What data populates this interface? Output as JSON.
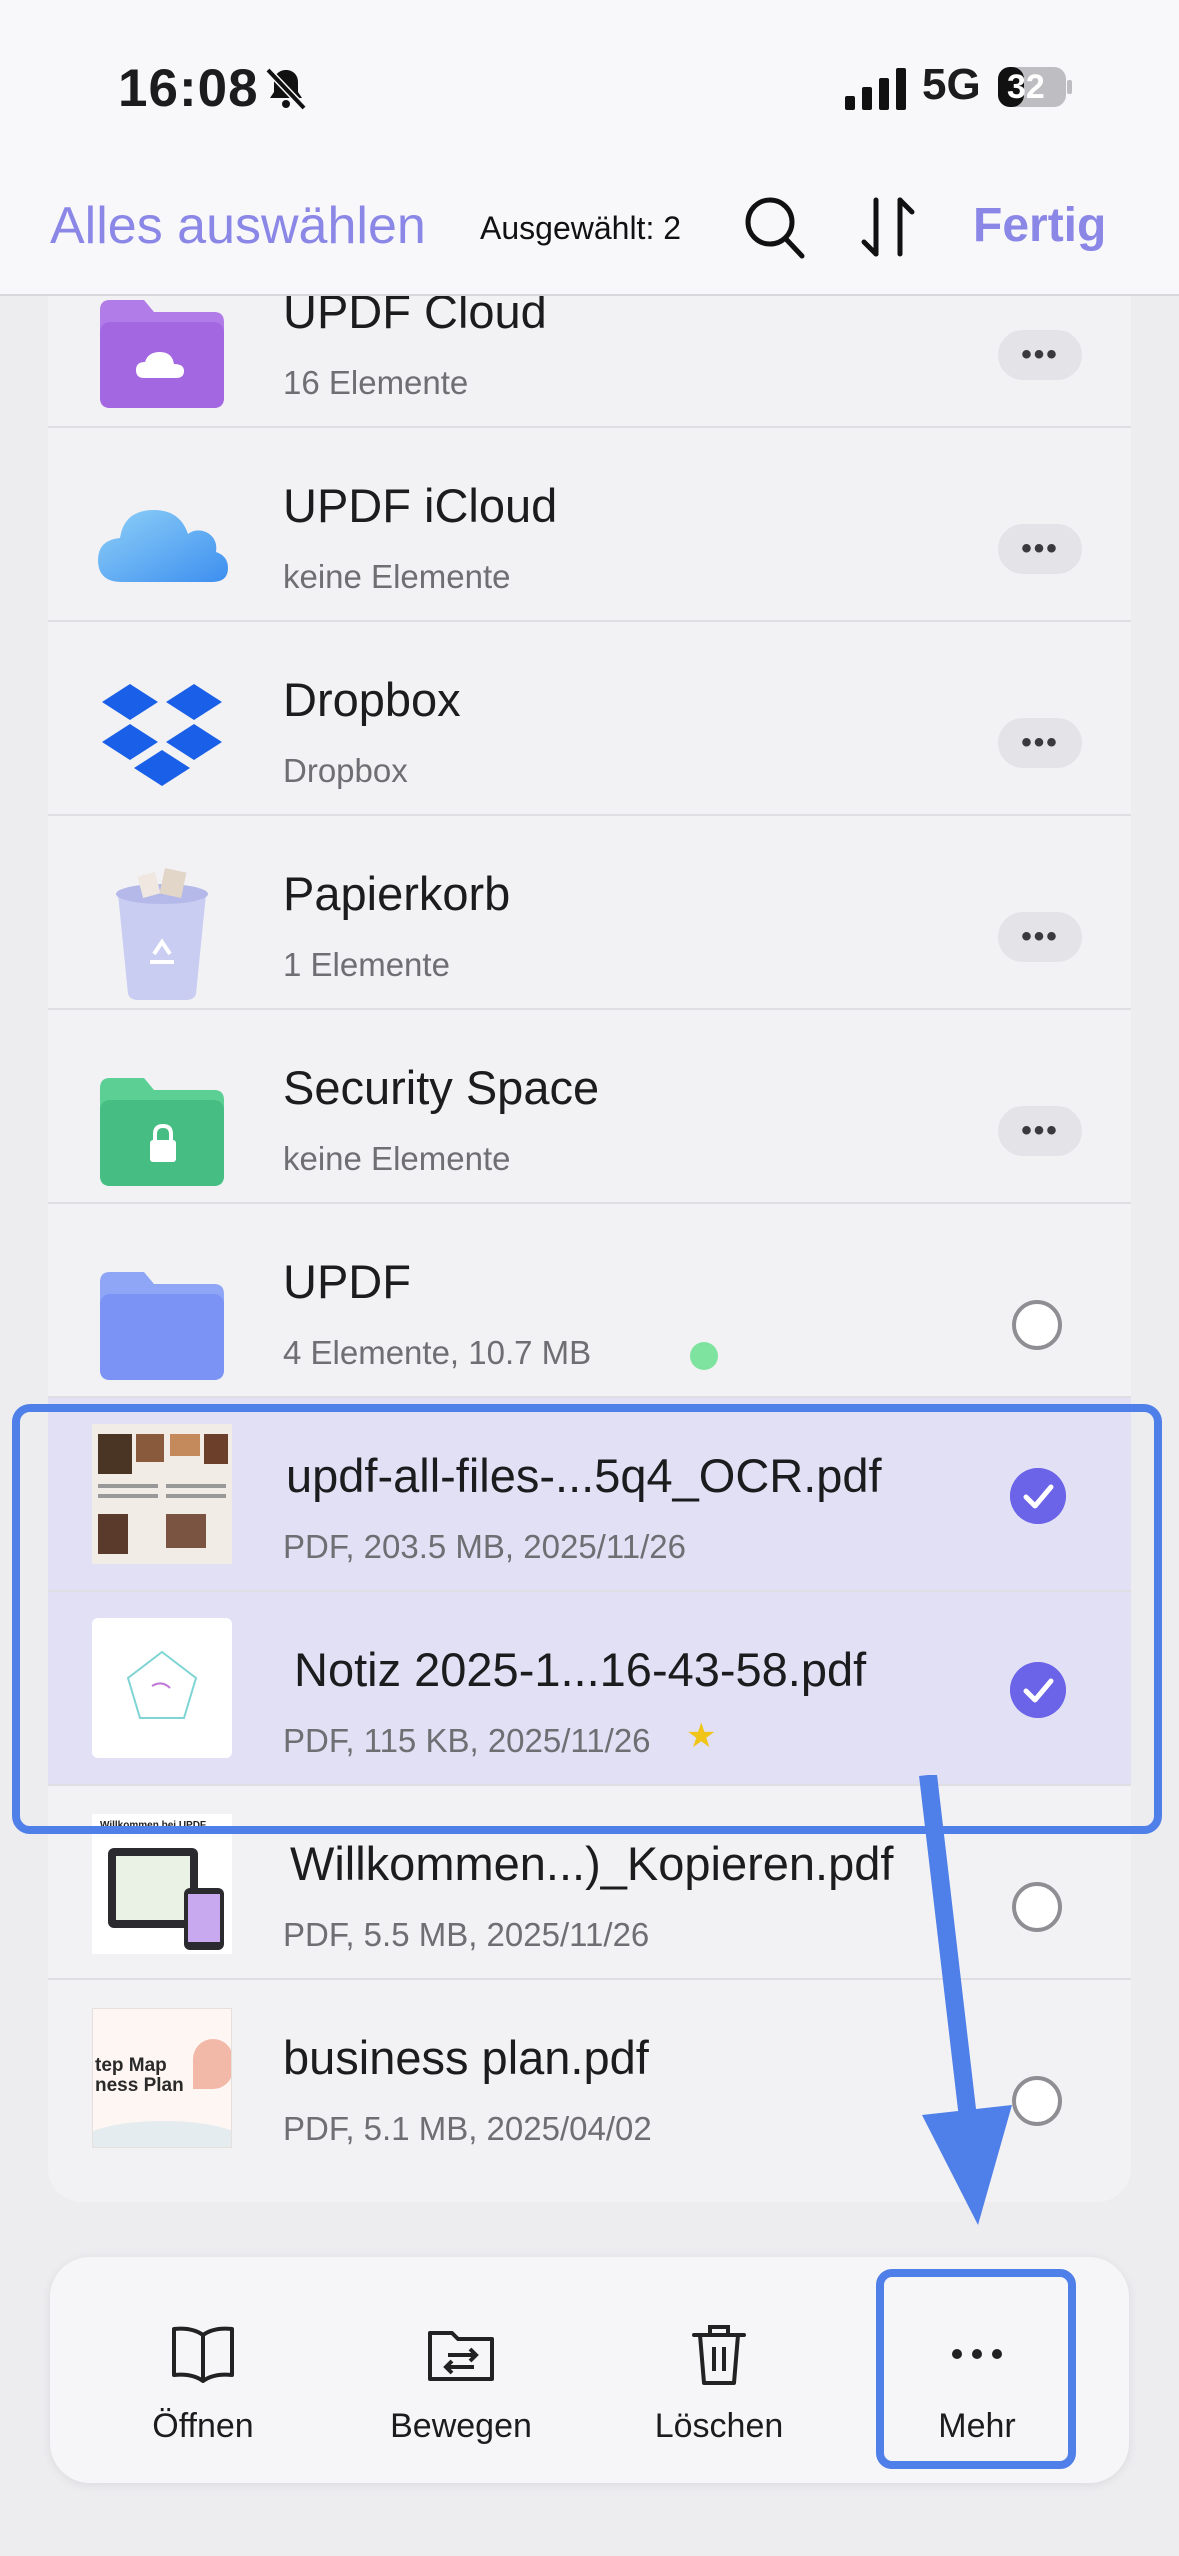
{
  "status_bar": {
    "time": "16:08",
    "network": "5G",
    "battery": "32"
  },
  "header": {
    "select_all": "Alles auswählen",
    "selected_count": "Ausgewählt: 2",
    "done": "Fertig"
  },
  "rows": [
    {
      "title": "UPDF Cloud",
      "subtitle": "16 Elemente",
      "icon": "cloud-folder-icon",
      "control": "more"
    },
    {
      "title": "UPDF iCloud",
      "subtitle": "keine Elemente",
      "icon": "icloud-icon",
      "control": "more"
    },
    {
      "title": "Dropbox",
      "subtitle": "Dropbox",
      "icon": "dropbox-icon",
      "control": "more"
    },
    {
      "title": "Papierkorb",
      "subtitle": "1 Elemente",
      "icon": "trash-bin-icon",
      "control": "more"
    },
    {
      "title": "Security Space",
      "subtitle": "keine Elemente",
      "icon": "locked-folder-icon",
      "control": "more"
    },
    {
      "title": "UPDF",
      "subtitle": "4 Elemente, 10.7 MB",
      "icon": "folder-icon",
      "control": "radio"
    },
    {
      "title": "updf-all-files-...5q4_OCR.pdf",
      "subtitle": "PDF, 203.5 MB, 2025/11/26",
      "icon": "pdf-thumbnail",
      "control": "checked"
    },
    {
      "title": "Notiz 2025-1...16-43-58.pdf",
      "subtitle": "PDF, 115 KB, 2025/11/26",
      "icon": "pdf-thumbnail",
      "control": "checked"
    },
    {
      "title": "Willkommen...)_Kopieren.pdf",
      "subtitle": "PDF, 5.5 MB, 2025/11/26",
      "icon": "pdf-thumbnail",
      "control": "radio"
    },
    {
      "title": "business plan.pdf",
      "subtitle": "PDF, 5.1 MB, 2025/04/02",
      "icon": "pdf-thumbnail",
      "control": "radio"
    }
  ],
  "thumb_text": {
    "welcome": "Willkommen bei UPDF",
    "business_line1": "tep Map",
    "business_line2": "ness Plan"
  },
  "toolbar": {
    "open": "Öffnen",
    "move": "Bewegen",
    "delete": "Löschen",
    "more": "Mehr"
  },
  "colors": {
    "accent": "#8b87e6",
    "check": "#6b63e8",
    "highlight": "#4f7fe8"
  }
}
